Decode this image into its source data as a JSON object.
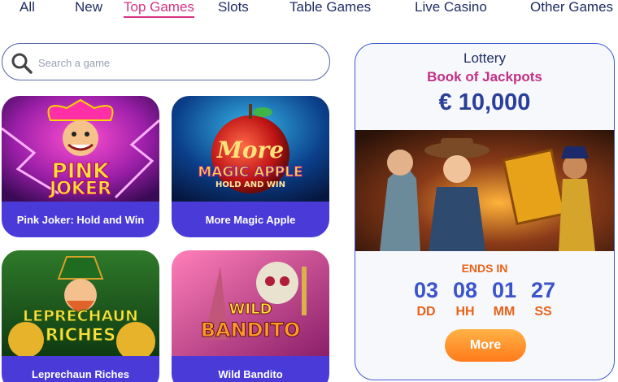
{
  "nav": {
    "tabs": [
      {
        "label": "All"
      },
      {
        "label": "New"
      },
      {
        "label": "Top Games"
      },
      {
        "label": "Slots"
      },
      {
        "label": "Table Games"
      },
      {
        "label": "Live Casino"
      },
      {
        "label": "Other Games"
      }
    ],
    "active": "Top Games"
  },
  "search": {
    "placeholder": "Search a game"
  },
  "games": [
    {
      "title": "Pink Joker: Hold and Win",
      "logo_line1": "PINK",
      "logo_line2": "JOKER"
    },
    {
      "title": "More Magic Apple",
      "logo_line1": "More",
      "logo_line2": "MAGIC APPLE",
      "logo_line3": "HOLD AND WIN"
    },
    {
      "title": "Leprechaun Riches",
      "logo_line1": "LEPRECHAUN",
      "logo_line2": "RICHES"
    },
    {
      "title": "Wild Bandito",
      "logo_line1": "WILD",
      "logo_line2": "BANDITO"
    }
  ],
  "lottery": {
    "label": "Lottery",
    "name": "Book of Jackpots",
    "prize": "€ 10,000",
    "ends_label": "ENDS IN",
    "countdown": [
      {
        "value": "03",
        "unit": "DD"
      },
      {
        "value": "08",
        "unit": "HH"
      },
      {
        "value": "01",
        "unit": "MM"
      },
      {
        "value": "27",
        "unit": "SS"
      }
    ],
    "button_label": "More"
  },
  "colors": {
    "accent_pink": "#d63384",
    "navy": "#1f2d63",
    "prize_blue": "#2a3f9a",
    "countdown_blue": "#3b54c9",
    "orange": "#e8621a",
    "caption_purple": "#4a3bd9"
  }
}
